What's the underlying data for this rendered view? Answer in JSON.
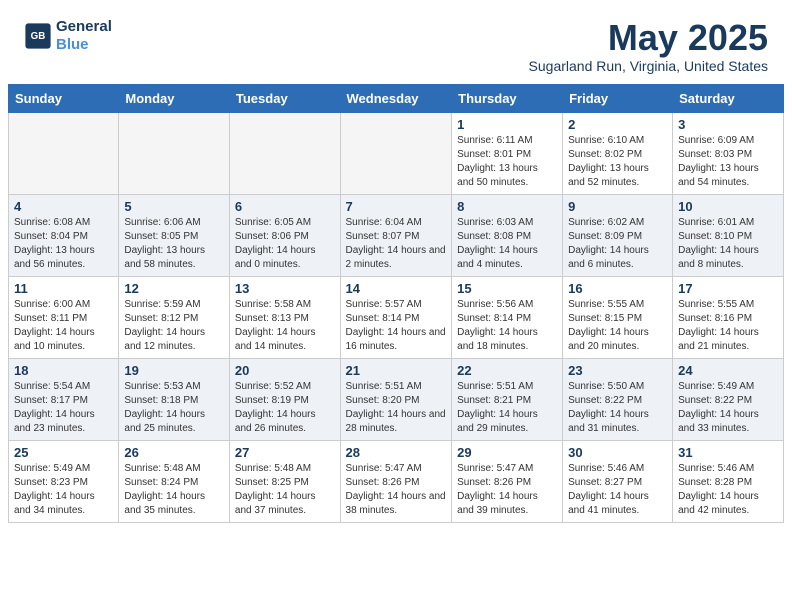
{
  "header": {
    "logo_line1": "General",
    "logo_line2": "Blue",
    "month_title": "May 2025",
    "subtitle": "Sugarland Run, Virginia, United States"
  },
  "weekdays": [
    "Sunday",
    "Monday",
    "Tuesday",
    "Wednesday",
    "Thursday",
    "Friday",
    "Saturday"
  ],
  "weeks": [
    [
      {
        "day": "",
        "empty": true
      },
      {
        "day": "",
        "empty": true
      },
      {
        "day": "",
        "empty": true
      },
      {
        "day": "",
        "empty": true
      },
      {
        "day": "1",
        "sunrise": "6:11 AM",
        "sunset": "8:01 PM",
        "daylight": "13 hours and 50 minutes."
      },
      {
        "day": "2",
        "sunrise": "6:10 AM",
        "sunset": "8:02 PM",
        "daylight": "13 hours and 52 minutes."
      },
      {
        "day": "3",
        "sunrise": "6:09 AM",
        "sunset": "8:03 PM",
        "daylight": "13 hours and 54 minutes."
      }
    ],
    [
      {
        "day": "4",
        "sunrise": "6:08 AM",
        "sunset": "8:04 PM",
        "daylight": "13 hours and 56 minutes."
      },
      {
        "day": "5",
        "sunrise": "6:06 AM",
        "sunset": "8:05 PM",
        "daylight": "13 hours and 58 minutes."
      },
      {
        "day": "6",
        "sunrise": "6:05 AM",
        "sunset": "8:06 PM",
        "daylight": "14 hours and 0 minutes."
      },
      {
        "day": "7",
        "sunrise": "6:04 AM",
        "sunset": "8:07 PM",
        "daylight": "14 hours and 2 minutes."
      },
      {
        "day": "8",
        "sunrise": "6:03 AM",
        "sunset": "8:08 PM",
        "daylight": "14 hours and 4 minutes."
      },
      {
        "day": "9",
        "sunrise": "6:02 AM",
        "sunset": "8:09 PM",
        "daylight": "14 hours and 6 minutes."
      },
      {
        "day": "10",
        "sunrise": "6:01 AM",
        "sunset": "8:10 PM",
        "daylight": "14 hours and 8 minutes."
      }
    ],
    [
      {
        "day": "11",
        "sunrise": "6:00 AM",
        "sunset": "8:11 PM",
        "daylight": "14 hours and 10 minutes."
      },
      {
        "day": "12",
        "sunrise": "5:59 AM",
        "sunset": "8:12 PM",
        "daylight": "14 hours and 12 minutes."
      },
      {
        "day": "13",
        "sunrise": "5:58 AM",
        "sunset": "8:13 PM",
        "daylight": "14 hours and 14 minutes."
      },
      {
        "day": "14",
        "sunrise": "5:57 AM",
        "sunset": "8:14 PM",
        "daylight": "14 hours and 16 minutes."
      },
      {
        "day": "15",
        "sunrise": "5:56 AM",
        "sunset": "8:14 PM",
        "daylight": "14 hours and 18 minutes."
      },
      {
        "day": "16",
        "sunrise": "5:55 AM",
        "sunset": "8:15 PM",
        "daylight": "14 hours and 20 minutes."
      },
      {
        "day": "17",
        "sunrise": "5:55 AM",
        "sunset": "8:16 PM",
        "daylight": "14 hours and 21 minutes."
      }
    ],
    [
      {
        "day": "18",
        "sunrise": "5:54 AM",
        "sunset": "8:17 PM",
        "daylight": "14 hours and 23 minutes."
      },
      {
        "day": "19",
        "sunrise": "5:53 AM",
        "sunset": "8:18 PM",
        "daylight": "14 hours and 25 minutes."
      },
      {
        "day": "20",
        "sunrise": "5:52 AM",
        "sunset": "8:19 PM",
        "daylight": "14 hours and 26 minutes."
      },
      {
        "day": "21",
        "sunrise": "5:51 AM",
        "sunset": "8:20 PM",
        "daylight": "14 hours and 28 minutes."
      },
      {
        "day": "22",
        "sunrise": "5:51 AM",
        "sunset": "8:21 PM",
        "daylight": "14 hours and 29 minutes."
      },
      {
        "day": "23",
        "sunrise": "5:50 AM",
        "sunset": "8:22 PM",
        "daylight": "14 hours and 31 minutes."
      },
      {
        "day": "24",
        "sunrise": "5:49 AM",
        "sunset": "8:22 PM",
        "daylight": "14 hours and 33 minutes."
      }
    ],
    [
      {
        "day": "25",
        "sunrise": "5:49 AM",
        "sunset": "8:23 PM",
        "daylight": "14 hours and 34 minutes."
      },
      {
        "day": "26",
        "sunrise": "5:48 AM",
        "sunset": "8:24 PM",
        "daylight": "14 hours and 35 minutes."
      },
      {
        "day": "27",
        "sunrise": "5:48 AM",
        "sunset": "8:25 PM",
        "daylight": "14 hours and 37 minutes."
      },
      {
        "day": "28",
        "sunrise": "5:47 AM",
        "sunset": "8:26 PM",
        "daylight": "14 hours and 38 minutes."
      },
      {
        "day": "29",
        "sunrise": "5:47 AM",
        "sunset": "8:26 PM",
        "daylight": "14 hours and 39 minutes."
      },
      {
        "day": "30",
        "sunrise": "5:46 AM",
        "sunset": "8:27 PM",
        "daylight": "14 hours and 41 minutes."
      },
      {
        "day": "31",
        "sunrise": "5:46 AM",
        "sunset": "8:28 PM",
        "daylight": "14 hours and 42 minutes."
      }
    ]
  ]
}
